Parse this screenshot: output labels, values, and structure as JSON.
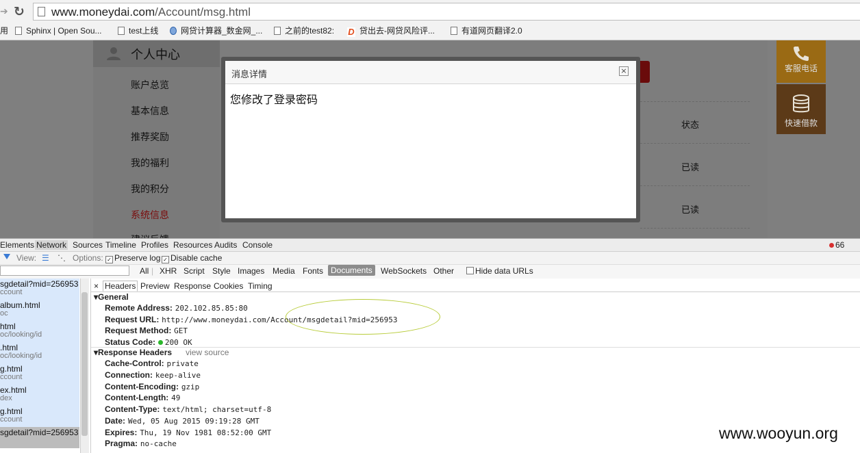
{
  "browser": {
    "url_host": "www.moneydai.com",
    "url_path": "/Account/msg.html",
    "bookmarks": [
      {
        "label": "用",
        "icon": "none"
      },
      {
        "label": "Sphinx | Open Sou...",
        "icon": "page-icon"
      },
      {
        "label": "test上线",
        "icon": "page-icon"
      },
      {
        "label": "网贷计算器_数金网_...",
        "icon": "globe-icon"
      },
      {
        "label": "之前的test82:",
        "icon": "page-icon"
      },
      {
        "label": "贷出去-网贷风险评...",
        "icon": "brand-icon"
      },
      {
        "label": "有道网页翻译2.0",
        "icon": "page-icon"
      }
    ]
  },
  "sidebar": {
    "title": "个人中心",
    "items": [
      "账户总览",
      "基本信息",
      "推荐奖励",
      "我的福利",
      "我的积分",
      "系统信息",
      "建议反馈"
    ],
    "active_index": 5
  },
  "main": {
    "column_header": "状态",
    "rows": [
      "已读",
      "已读"
    ]
  },
  "float_buttons": {
    "phone": "客服电话",
    "loan": "快速借款"
  },
  "modal": {
    "title": "消息详情",
    "close_glyph": "×",
    "body": "您修改了登录密码"
  },
  "devtools": {
    "tabs": [
      "Elements",
      "Network",
      "Sources",
      "Timeline",
      "Profiles",
      "Resources",
      "Audits",
      "Console"
    ],
    "selected_tab": "Network",
    "error_count": "66",
    "toolbar": {
      "view_label": "View:",
      "options_label": "Options:",
      "preserve_log": "Preserve log",
      "disable_cache": "Disable cache"
    },
    "filters": [
      "All",
      "XHR",
      "Script",
      "Style",
      "Images",
      "Media",
      "Fonts",
      "Documents",
      "WebSockets",
      "Other"
    ],
    "selected_filter": "Documents",
    "hide_data_urls": "Hide data URLs",
    "requests": [
      {
        "name": "sgdetail?mid=256953",
        "domain": "ccount"
      },
      {
        "name": "album.html",
        "domain": "oc"
      },
      {
        "name": "html",
        "domain": "oc/looking/id"
      },
      {
        "name": ".html",
        "domain": "oc/looking/id"
      },
      {
        "name": "g.html",
        "domain": "ccount"
      },
      {
        "name": "ex.html",
        "domain": "dex"
      },
      {
        "name": "g.html",
        "domain": "ccount"
      },
      {
        "name": "sgdetail?mid=256953",
        "domain": ""
      }
    ],
    "detail_tabs": [
      "×",
      "Headers",
      "Preview",
      "Response",
      "Cookies",
      "Timing"
    ],
    "general": {
      "title": "General",
      "remote_address_k": "Remote Address:",
      "remote_address_v": "202.102.85.85:80",
      "request_url_k": "Request URL:",
      "request_url_v": "http://www.moneydai.com/Account/msgdetail?mid=256953",
      "request_method_k": "Request Method:",
      "request_method_v": "GET",
      "status_code_k": "Status Code:",
      "status_code_v": "200 OK"
    },
    "response_headers": {
      "title": "Response Headers",
      "view_source": "view source",
      "items": [
        {
          "k": "Cache-Control:",
          "v": "private"
        },
        {
          "k": "Connection:",
          "v": "keep-alive"
        },
        {
          "k": "Content-Encoding:",
          "v": "gzip"
        },
        {
          "k": "Content-Length:",
          "v": "49"
        },
        {
          "k": "Content-Type:",
          "v": "text/html; charset=utf-8"
        },
        {
          "k": "Date:",
          "v": "Wed, 05 Aug 2015 09:19:28 GMT"
        },
        {
          "k": "Expires:",
          "v": "Thu, 19 Nov 1981 08:52:00 GMT"
        },
        {
          "k": "Pragma:",
          "v": "no-cache"
        }
      ]
    }
  },
  "watermark": "www.wooyun.org"
}
